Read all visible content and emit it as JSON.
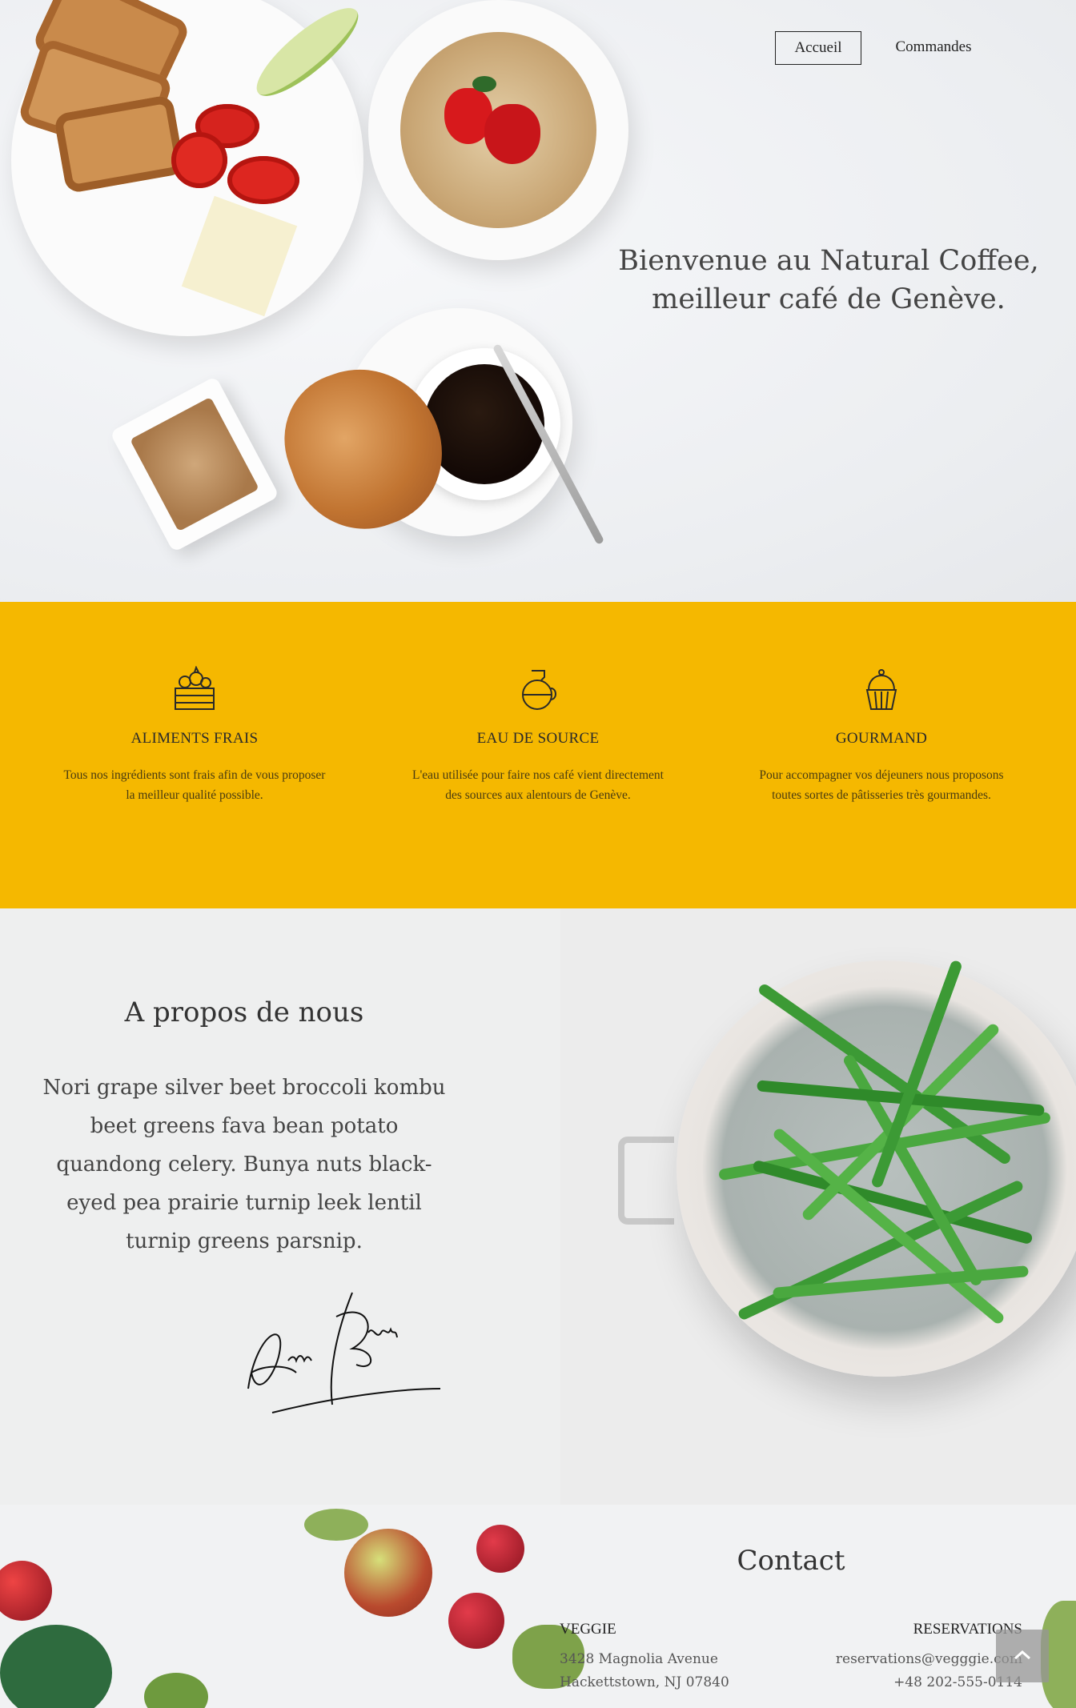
{
  "nav": {
    "items": [
      {
        "label": "Accueil"
      },
      {
        "label": "Commandes"
      }
    ]
  },
  "hero": {
    "title_line1": "Bienvenue au Natural Coffee,",
    "title_line2": "meilleur café de Genève."
  },
  "features": [
    {
      "icon": "vegetable-crate-icon",
      "title": "ALIMENTS FRAIS",
      "text": "Tous nos ingrédients sont frais afin de vous proposer la meilleur qualité possible."
    },
    {
      "icon": "coffee-pot-icon",
      "title": "EAU DE SOURCE",
      "text": "L'eau utilisée pour faire nos café vient directement des sources aux alentours de Genève."
    },
    {
      "icon": "cupcake-icon",
      "title": "GOURMAND",
      "text": "Pour accompagner vos déjeuners nous proposons toutes sortes de pâtisseries très gourmandes."
    }
  ],
  "about": {
    "title": "A propos de nous",
    "text": "Nori grape silver beet broccoli kombu beet greens fava bean potato quandong celery. Bunya nuts black-eyed pea prairie turnip leek lentil turnip greens parsnip."
  },
  "contact": {
    "title": "Contact",
    "left": {
      "heading": "VEGGIE",
      "line1": "3428 Magnolia Avenue",
      "line2": "Hackettstown, NJ 07840"
    },
    "right": {
      "heading": "RESERVATIONS",
      "line1": "reservations@vegggie.com",
      "line2": "+48 202-555-0114"
    }
  },
  "colors": {
    "accent": "#f5b800",
    "text": "#333333"
  },
  "icons": {
    "back_to_top": "chevron-up-icon"
  }
}
